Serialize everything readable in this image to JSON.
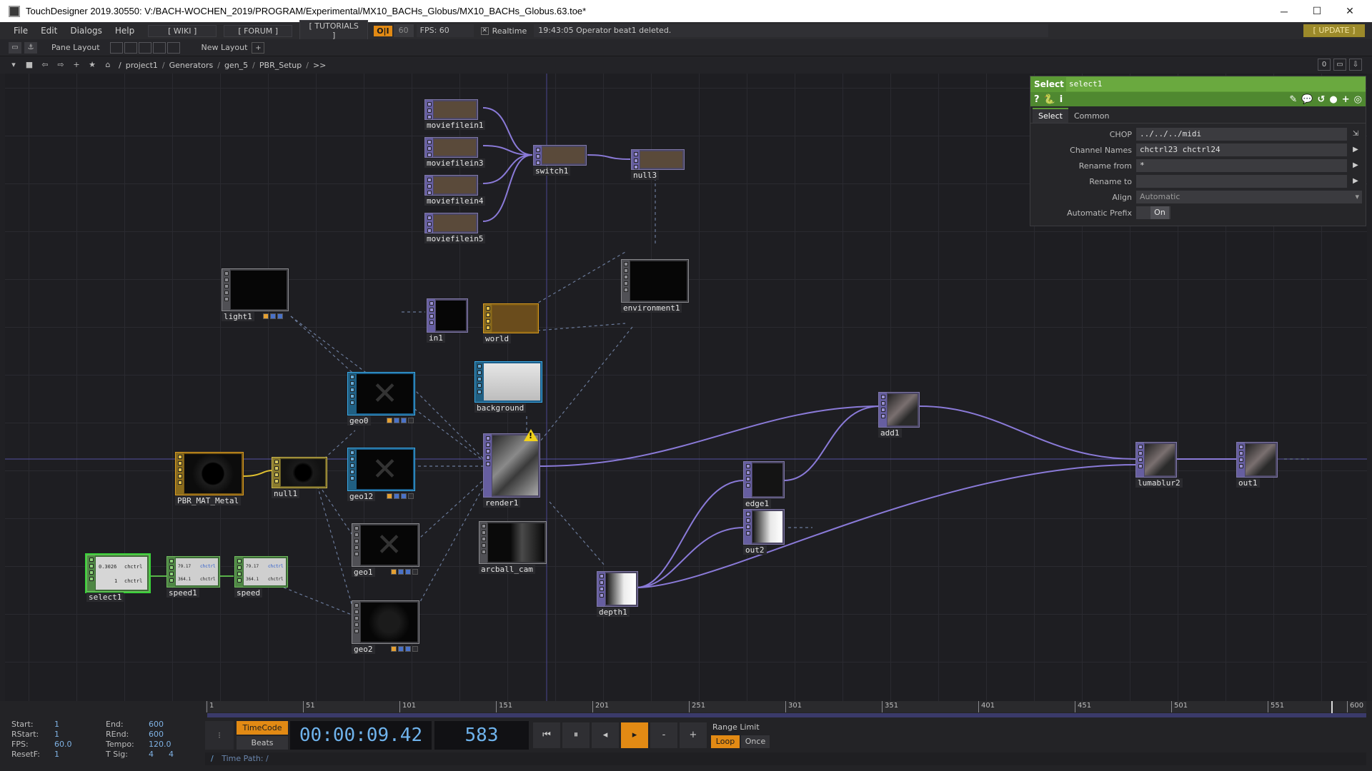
{
  "titlebar": {
    "title": "TouchDesigner 2019.30550: V:/BACH-WOCHEN_2019/PROGRAM/Experimental/MX10_BACHs_Globus/MX10_BACHs_Globus.63.toe*",
    "minimize": "─",
    "maximize": "☐",
    "close": "✕"
  },
  "menubar": {
    "items": [
      "File",
      "Edit",
      "Dialogs",
      "Help"
    ],
    "wiki": "[ WIKI ]",
    "forum": "[ FORUM ]",
    "tutorials": "[ TUTORIALS ]",
    "oi": "O|I",
    "cook_rate": "60",
    "fps": "FPS:  60",
    "realtime_check": "✕",
    "realtime": "Realtime",
    "status": "19:43:05 Operator beat1 deleted.",
    "update": "[ UPDATE ]"
  },
  "paneline": {
    "pane_layout": "Pane Layout",
    "new_layout": "New Layout",
    "add": "+"
  },
  "pathbar": {
    "crumbs": [
      "/",
      "project1",
      "/",
      "Generators",
      "/",
      "gen_5",
      "/",
      "PBR_Setup",
      "/",
      ">>"
    ],
    "right_buttons": [
      "0",
      "▭",
      "⇩"
    ]
  },
  "nodes": {
    "moviefilein1": "moviefilein1",
    "moviefilein3": "moviefilein3",
    "moviefilein4": "moviefilein4",
    "moviefilein5": "moviefilein5",
    "switch1": "switch1",
    "null3": "null3",
    "light1": "light1",
    "in1": "in1",
    "world": "world",
    "environment1": "environment1",
    "geo0": "geo0",
    "background": "background",
    "PBR_MAT_Metal": "PBR_MAT_Metal",
    "null1": "null1",
    "geo12": "geo12",
    "render1": "render1",
    "add1": "add1",
    "edge1": "edge1",
    "lumablur2": "lumablur2",
    "out1": "out1",
    "out2": "out2",
    "geo1": "geo1",
    "arcball_cam": "arcball_cam",
    "select1": "select1",
    "speed1": "speed1",
    "speed": "speed",
    "depth1": "depth1",
    "geo2": "geo2",
    "warning": "!"
  },
  "chop_values": {
    "select1_a": "0.3026",
    "select1_b": "1",
    "select1_c1": "chctrl",
    "select1_c2": "chctrl",
    "speed1_a": "79.17",
    "speed1_b": "364.1",
    "speed1_c1": "chctrl",
    "speed1_c2": "chctrl",
    "speed_a": "79.17",
    "speed_b": "364.1",
    "speed_c1": "chctrl",
    "speed_c2": "chctrl"
  },
  "param": {
    "kind": "Select",
    "name": "select1",
    "tools": [
      "?",
      "🐍",
      "i"
    ],
    "tools_right": [
      "✎",
      "💬",
      "↺",
      "●",
      "+",
      "◎"
    ],
    "tabs": [
      "Select",
      "Common"
    ],
    "rows": [
      {
        "label": "CHOP",
        "value": "../../../midi"
      },
      {
        "label": "Channel Names",
        "value": "chctrl23 chctrl24"
      },
      {
        "label": "Rename from",
        "value": "*"
      },
      {
        "label": "Rename to",
        "value": ""
      },
      {
        "label": "Align",
        "value": "Automatic"
      },
      {
        "label": "Automatic Prefix",
        "value": "On"
      }
    ]
  },
  "timeline": {
    "ticks": [
      "1",
      "51",
      "101",
      "151",
      "201",
      "251",
      "301",
      "351",
      "401",
      "451",
      "501",
      "551",
      "600"
    ],
    "info": {
      "start_k": "Start:",
      "start_v": "1",
      "end_k": "End:",
      "end_v": "600",
      "rstart_k": "RStart:",
      "rstart_v": "1",
      "rend_k": "REnd:",
      "rend_v": "600",
      "fps_k": "FPS:",
      "fps_v": "60.0",
      "tempo_k": "Tempo:",
      "tempo_v": "120.0",
      "resetf_k": "ResetF:",
      "resetf_v": "1",
      "tsig_k": "T Sig:",
      "tsig_v": "4      4"
    },
    "timecode": "TimeCode",
    "beats": "Beats",
    "time": "00:00:09.42",
    "frame": "583",
    "buttons": [
      "⏮",
      "⏸",
      "◂",
      "▸",
      "-",
      "+"
    ],
    "range_limit": "Range Limit",
    "loop": "Loop",
    "once": "Once",
    "time_path_slash": "/",
    "time_path": "Time Path: /",
    "playhead_fraction": 0.97
  }
}
